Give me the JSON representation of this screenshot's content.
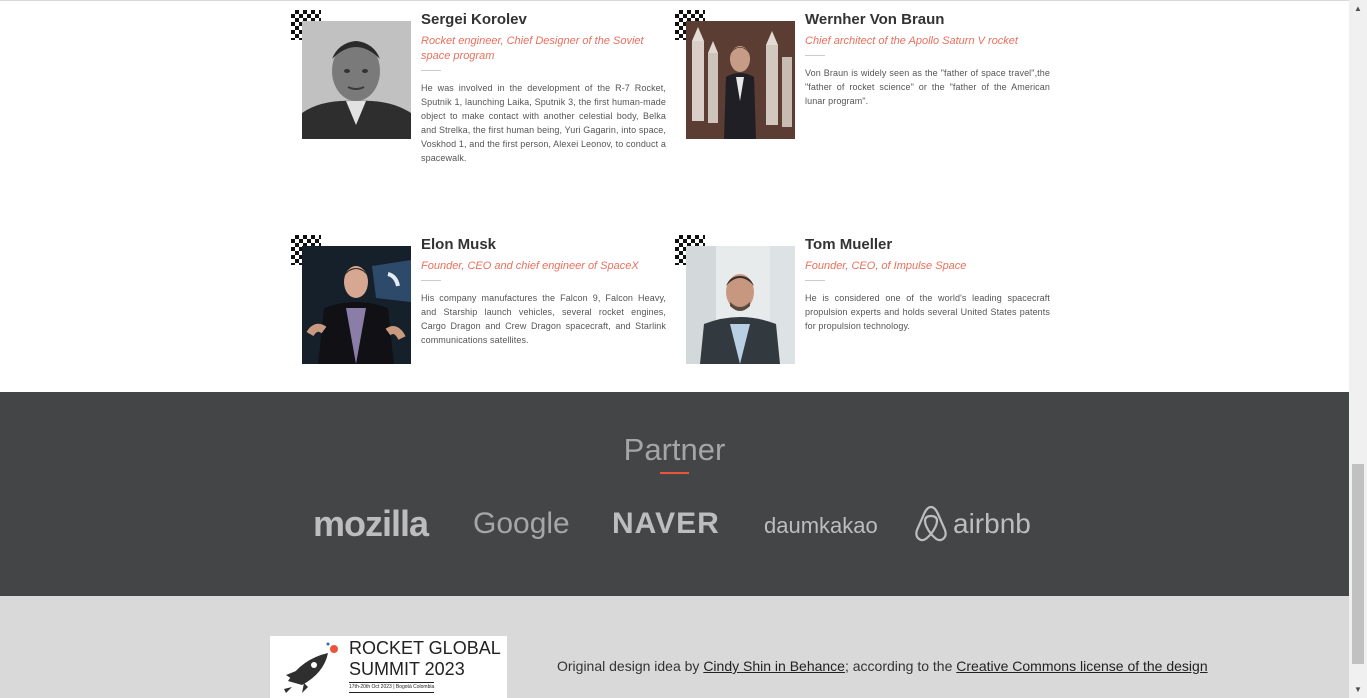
{
  "speakers": [
    {
      "name": "Sergei Korolev",
      "role": "Rocket engineer, Chief Designer of the Soviet space program",
      "bio": "He was involved in the development of the R-7 Rocket, Sputnik 1, launching Laika, Sputnik 3, the first human-made object to make contact with another celestial body, Belka and Strelka, the first human being, Yuri Gagarin, into space, Voskhod 1, and the first person, Alexei Leonov, to conduct a spacewalk."
    },
    {
      "name": "Wernher Von Braun",
      "role": "Chief architect of the Apollo Saturn V rocket",
      "bio": "Von Braun is widely seen as the \"father of space travel\",the \"father of rocket science\" or the \"father of the American lunar program\"."
    },
    {
      "name": "Elon Musk",
      "role": "Founder, CEO and chief engineer of SpaceX",
      "bio": "His company manufactures the Falcon 9, Falcon Heavy, and Starship launch vehicles, several rocket engines, Cargo Dragon and Crew Dragon spacecraft, and Starlink communications satellites."
    },
    {
      "name": "Tom Mueller",
      "role": "Founder, CEO, of Impulse Space",
      "bio": "He is considered one of the world's leading spacecraft propulsion experts and holds several United States patents for propulsion technology."
    }
  ],
  "partner": {
    "title": "Partner",
    "logos": [
      "mozilla",
      "Google",
      "NAVER",
      "daumkakao",
      "airbnb"
    ]
  },
  "footer": {
    "logo_line1": "ROCKET GLOBAL",
    "logo_line2": "SUMMIT 2023",
    "logo_line3": "17th-20th Oct 2023 | Bogotá Colombia",
    "credit_prefix": "Original design idea by ",
    "credit_link1": "Cindy Shin in Behance",
    "credit_middle": "; according to the ",
    "credit_link2": "Creative Commons license of the design"
  },
  "colors": {
    "accent": "#e8705c",
    "partner_bg": "#444547",
    "footer_bg": "#d9d9d9"
  },
  "icons": {
    "scroll_up": "▲",
    "scroll_down": "▼"
  }
}
